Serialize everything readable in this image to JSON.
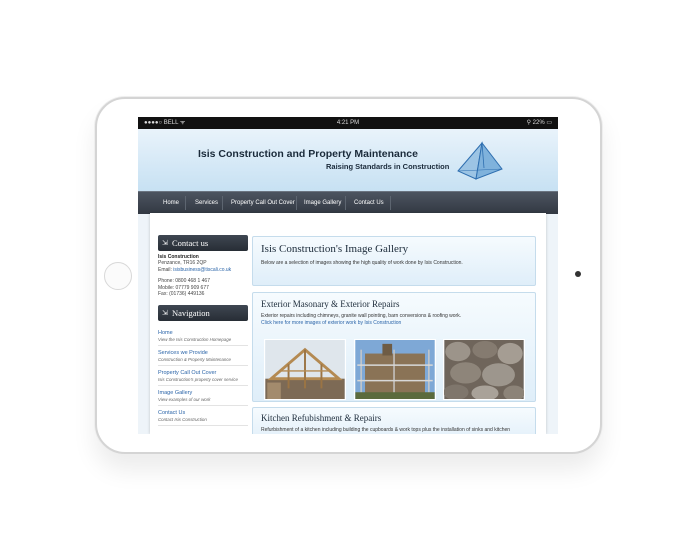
{
  "status_bar": {
    "carrier": "●●●●○ BELL ᯤ",
    "time": "4:21 PM",
    "battery": "⚲ 22% ▭"
  },
  "site": {
    "title": "Isis Construction and Property Maintenance",
    "tagline": "Raising Standards in Construction",
    "nav": [
      "Home",
      "Services",
      "Property Call Out Cover",
      "Image Gallery",
      "Contact Us"
    ]
  },
  "sidebar": {
    "contact_heading": "Contact us",
    "company": "Isis Construction",
    "address": "Penzance, TR16 2QP",
    "email_label": "Email:",
    "email": "isisbusiness@tiscali.co.uk",
    "phone": "Phone: 0800 468 1 467",
    "mobile": "Mobile: 07779 909 677",
    "fax": "Fax: (01736) 449136",
    "nav_heading": "Navigation",
    "nav_items": [
      {
        "title": "Home",
        "desc": "View the Isis Construction Homepage"
      },
      {
        "title": "Services we Provide",
        "desc": "Construction & Property Maintenance"
      },
      {
        "title": "Property Call Out Cover",
        "desc": "Isis Construction's property cover service"
      },
      {
        "title": "Image Gallery",
        "desc": "View examples of our work"
      },
      {
        "title": "Contact Us",
        "desc": "Contact Isis Construction"
      }
    ]
  },
  "main": {
    "gallery_title": "Isis Construction's Image Gallery",
    "gallery_intro": "Below are a selection of images showing the high quality of work done by Isis Construction.",
    "section1_title": "Exterior Masonary & Exterior Repairs",
    "section1_text": "Exterior repairs including chimneys, granite wall pointing, barn conversions & roofing work.",
    "section1_link": "Click here for more images of exterior work by Isis Construction",
    "section2_title": "Kitchen Refubishment & Repairs",
    "section2_text": "Refurbishment of a kitchen including building the cupboards & work tops plus the installation of sinks and kitchen"
  },
  "colors": {
    "accent_link": "#2a64a8",
    "nav_bar": "#3a414b",
    "header_blue": "#cfe5f5"
  }
}
